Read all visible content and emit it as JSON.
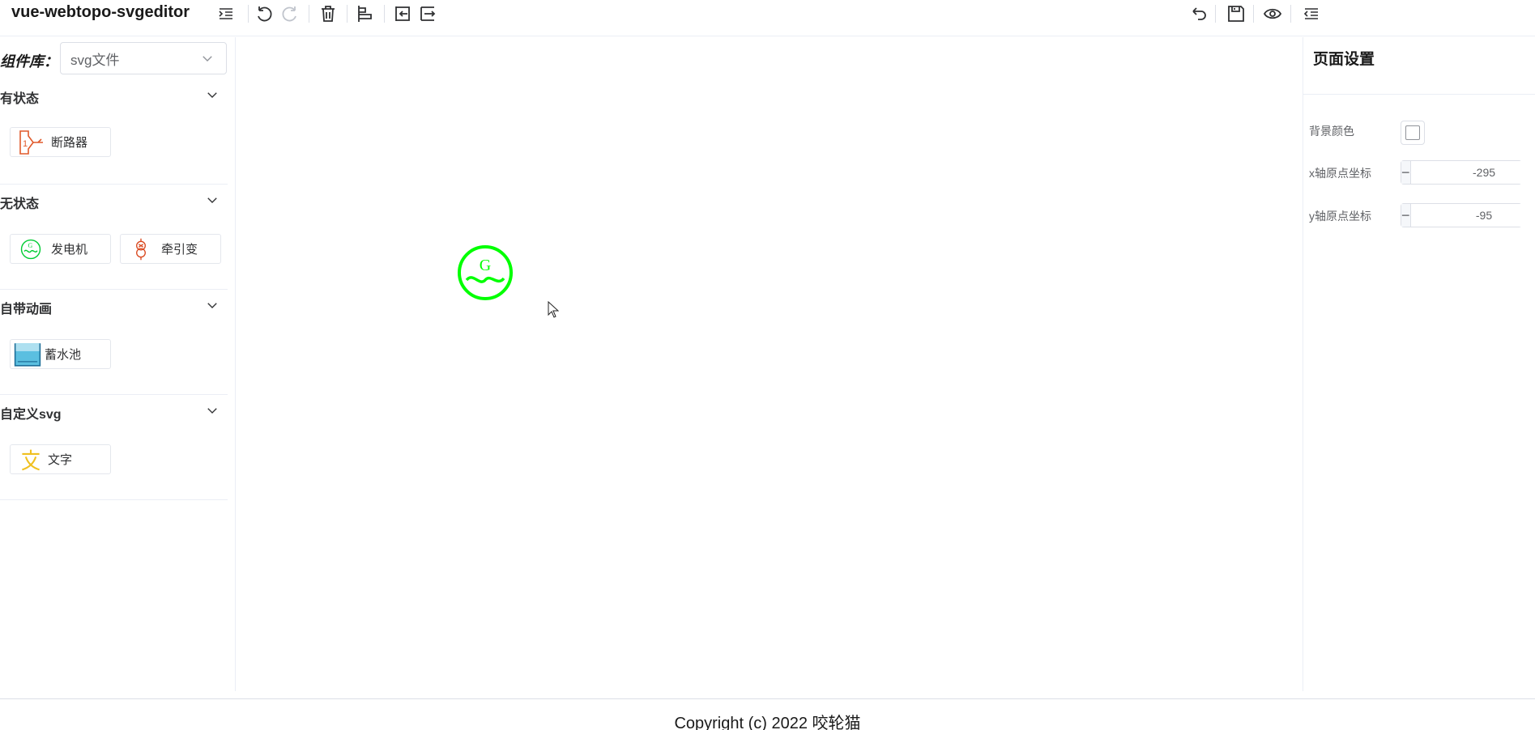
{
  "header": {
    "title": "vue-webtopo-svgeditor",
    "toolbar_left": [
      "indent-icon",
      "undo-icon",
      "redo-icon",
      "delete-icon",
      "align-icon",
      "move-left-icon",
      "move-right-icon"
    ],
    "toolbar_right": [
      "return-icon",
      "save-icon",
      "preview-icon",
      "outdent-icon"
    ]
  },
  "left_panel": {
    "library_label": "组件库：",
    "library_select": {
      "value": "svg文件"
    },
    "categories": [
      {
        "title": "有状态",
        "items": [
          {
            "label": "断路器",
            "icon": "circuit-breaker-icon"
          }
        ]
      },
      {
        "title": "无状态",
        "items": [
          {
            "label": "发电机",
            "icon": "generator-icon"
          },
          {
            "label": "牵引变",
            "icon": "traction-transformer-icon"
          }
        ]
      },
      {
        "title": "自带动画",
        "items": [
          {
            "label": "蓄水池",
            "icon": "reservoir-icon"
          }
        ]
      },
      {
        "title": "自定义svg",
        "items": [
          {
            "label": "文字",
            "icon": "text-icon"
          }
        ]
      }
    ]
  },
  "canvas": {
    "placed_component": {
      "label": "G",
      "icon": "generator-icon",
      "color": "#00ff00"
    }
  },
  "right_panel": {
    "title": "页面设置",
    "bg_color_label": "背景颜色",
    "x_origin_label": "x轴原点坐标",
    "x_origin_value": "-295",
    "y_origin_label": "y轴原点坐标",
    "y_origin_value": "-95"
  },
  "footer": {
    "copyright": "Copyright (c) 2022  咬轮猫"
  }
}
